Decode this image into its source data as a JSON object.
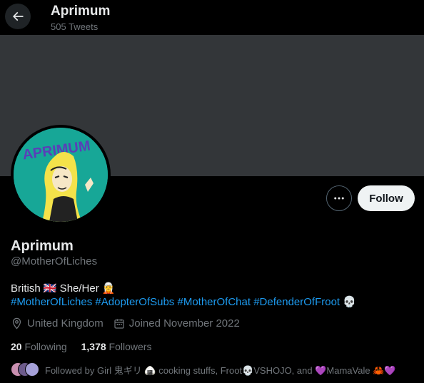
{
  "header": {
    "title": "Aprimum",
    "tweet_count": "505 Tweets"
  },
  "profile": {
    "avatar_text": "APRIMUM",
    "display_name": "Aprimum",
    "handle": "@MotherOfLiches",
    "bio_line1": "British 🇬🇧 She/Her 🧝",
    "hashtags": [
      "#MotherOfLiches",
      "#AdopterOfSubs",
      "#MotherOfChat",
      "#DefenderOfFroot"
    ],
    "bio_line2_suffix": "💀",
    "location": "United Kingdom",
    "joined": "Joined November 2022",
    "following_count": "20",
    "following_label": "Following",
    "followers_count": "1,378",
    "followers_label": "Followers",
    "followed_by": "Followed by Girl 鬼ギリ 🍙 cooking stuffs, Froot💀VSHOJO, and 💜MamaVale 🦀💜"
  },
  "actions": {
    "follow_label": "Follow",
    "more_label": "More"
  },
  "colors": {
    "accent": "#1d9bf0",
    "banner": "#333639",
    "avatar_bg": "#17a797"
  }
}
